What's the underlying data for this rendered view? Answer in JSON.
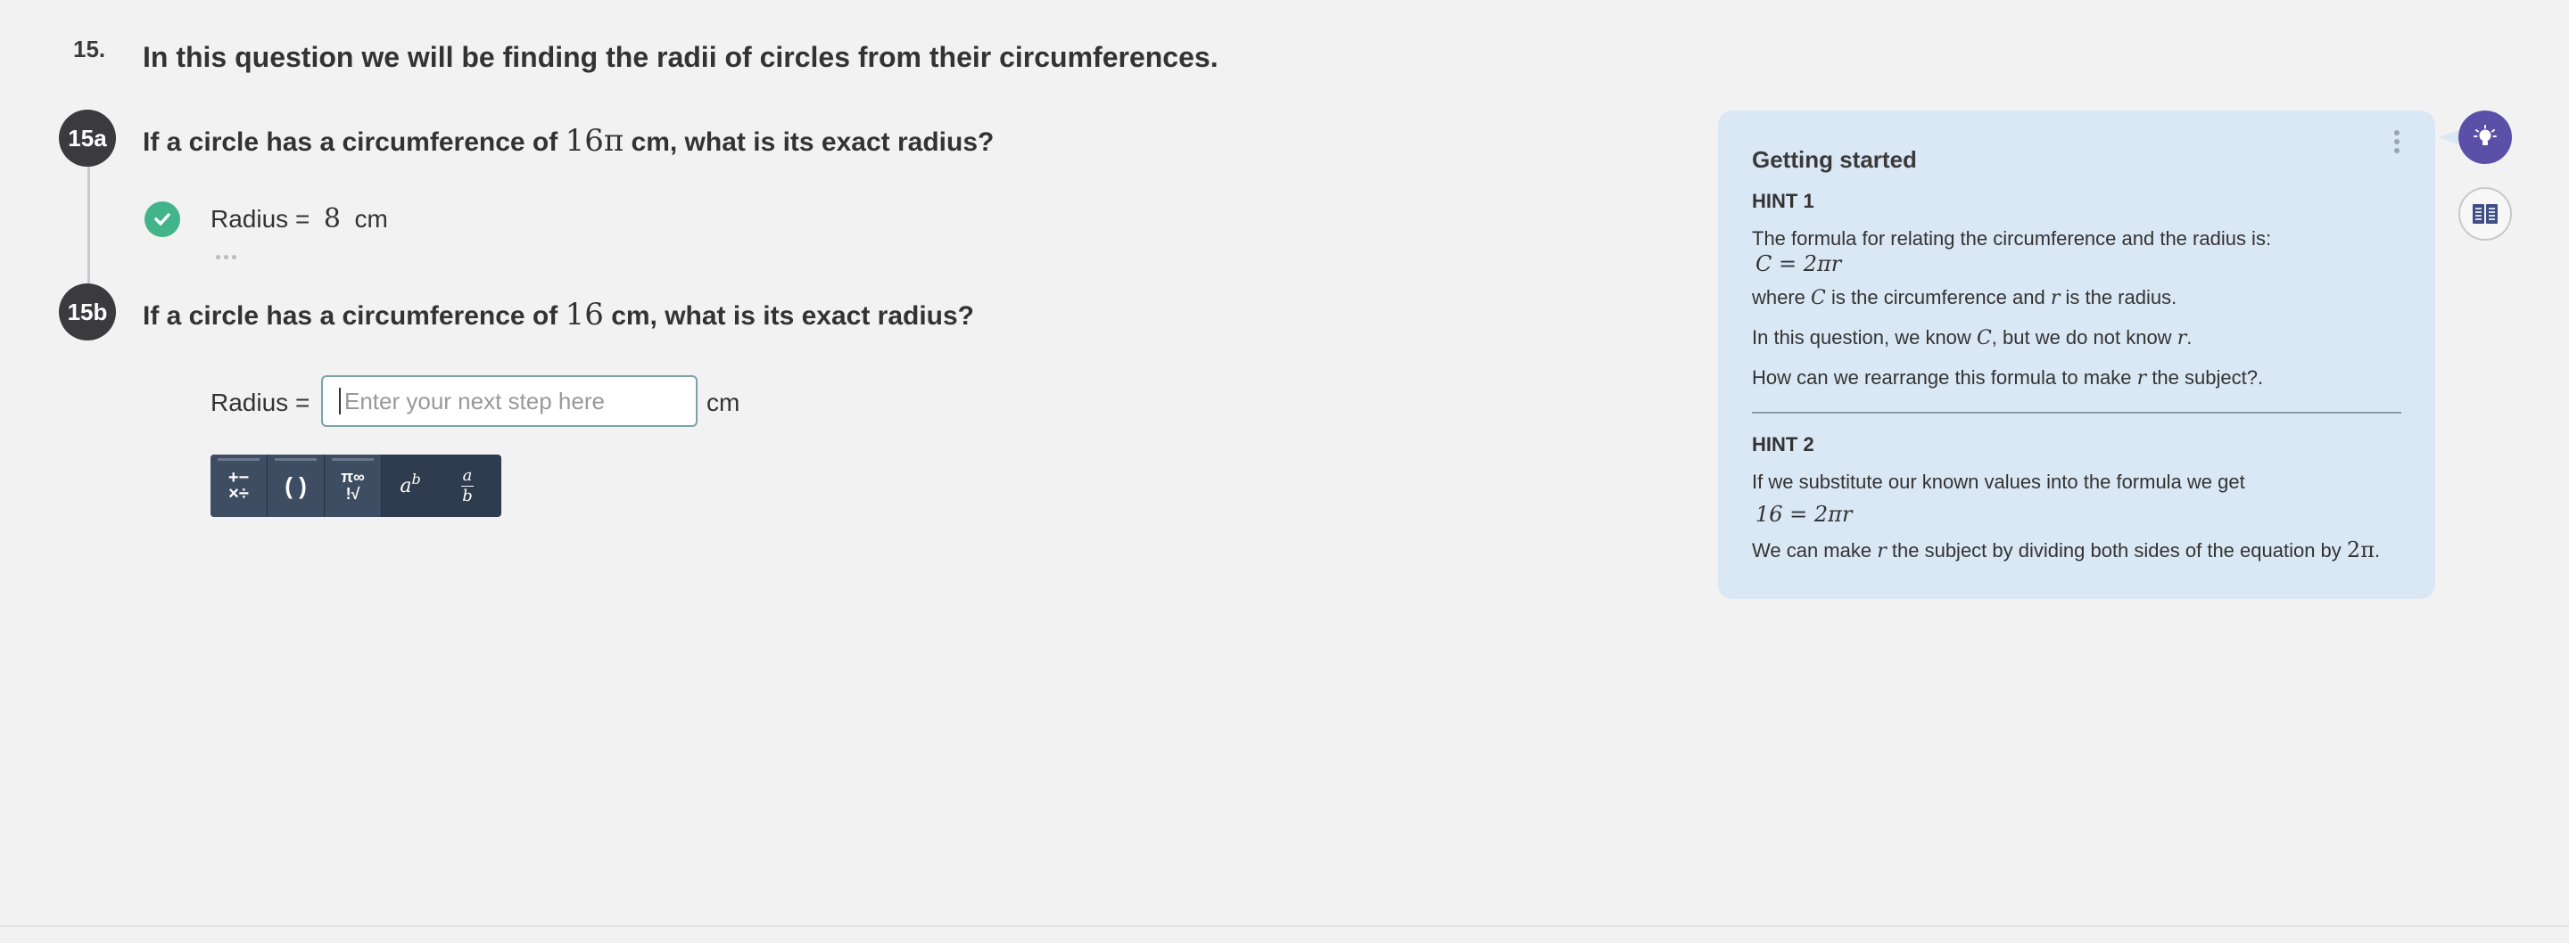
{
  "question": {
    "number": "15.",
    "title": "In this question we will be finding the radii of circles from their circumferences."
  },
  "part_a": {
    "badge": "15a",
    "text_before": "If a circle has a circumference of",
    "value": "16π",
    "text_after": "cm, what is its exact radius?",
    "answer_label": "Radius =",
    "answer_value": "8",
    "answer_unit": "cm",
    "status": "correct"
  },
  "part_b": {
    "badge": "15b",
    "text_before": "If a circle has a circumference of",
    "value": "16",
    "text_after": "cm, what is its exact radius?",
    "answer_label": "Radius =",
    "input_placeholder": "Enter your next step here",
    "answer_unit": "cm"
  },
  "math_toolbar": {
    "buttons": [
      {
        "name": "operators",
        "label_top": "+−",
        "label_bottom": "×÷"
      },
      {
        "name": "brackets",
        "label": "( )"
      },
      {
        "name": "symbols",
        "label_top": "π∞",
        "label_bottom": "!√"
      },
      {
        "name": "power",
        "base": "a",
        "exp": "b"
      },
      {
        "name": "fraction",
        "num": "a",
        "den": "b"
      }
    ]
  },
  "hint_panel": {
    "heading": "Getting started",
    "hint1": {
      "title": "HINT 1",
      "line1": "The formula for relating the circumference and the radius is:",
      "formula": "C = 2πr",
      "line2_a": "where",
      "line2_var1": "C",
      "line2_b": "is the circumference and",
      "line2_var2": "r",
      "line2_c": "is the radius.",
      "line3_a": "In this question, we know",
      "line3_var1": "C",
      "line3_b": ", but we do not know",
      "line3_var2": "r",
      "line3_c": ".",
      "line4_a": "How can we rearrange this formula to make",
      "line4_var": "r",
      "line4_b": "the subject?."
    },
    "hint2": {
      "title": "HINT 2",
      "line1": "If we substitute our known values into the formula we get",
      "formula": "16 = 2πr",
      "line2_a": "We can make",
      "line2_var": "r",
      "line2_b": "the subject by dividing both sides of the equation by",
      "line2_val": "2π",
      "line2_c": "."
    }
  },
  "colors": {
    "background": "#f2f2f3",
    "badge": "#3b3b3d",
    "correct": "#43b38b",
    "hint_bg": "#dae7f5",
    "hint_button": "#5b4fa8",
    "toolbar": "#2f3b4e"
  },
  "icons": [
    "check-icon",
    "lightbulb-icon",
    "book-icon",
    "more-vertical-icon"
  ]
}
